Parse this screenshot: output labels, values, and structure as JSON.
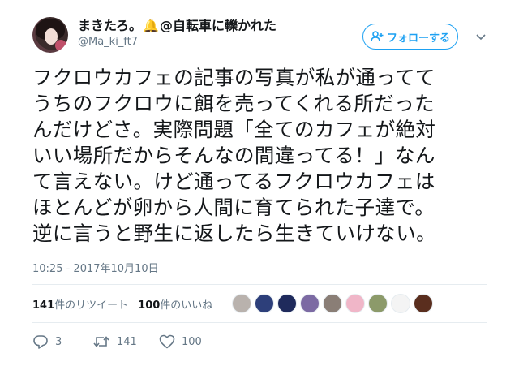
{
  "user": {
    "display_name_prefix": "まきたろ。",
    "display_name_suffix": "@自転車に轢かれた",
    "handle": "@Ma_ki_ft7"
  },
  "follow_button": {
    "label": "フォローする"
  },
  "tweet": {
    "lines": [
      "フクロウカフェの記事の写真が私が通ってて",
      "うちのフクロウに餌を売ってくれる所だった",
      "んだけどさ。実際問題「全てのカフェが絶対",
      "いい場所だからそんなの間違ってる！」なん",
      "て言えない。けど通ってるフクロウカフェは",
      "ほとんどが卵から人間に育てられた子達で。",
      "逆に言うと野生に返したら生きていけない。"
    ],
    "timestamp": "10:25 - 2017年10月10日"
  },
  "stats": {
    "retweets_count": "141",
    "retweets_label": "件のリツイート",
    "likes_count": "100",
    "likes_label": "件のいいね"
  },
  "likers": [
    {
      "icon": "liker-avatar-1",
      "color": "#b9b2ad"
    },
    {
      "icon": "liker-avatar-2",
      "color": "#2d3f7a"
    },
    {
      "icon": "liker-avatar-3",
      "color": "#1f2a5c"
    },
    {
      "icon": "liker-avatar-4",
      "color": "#7c6aa3"
    },
    {
      "icon": "liker-avatar-5",
      "color": "#8a7e76"
    },
    {
      "icon": "liker-avatar-6",
      "color": "#f0b6c8"
    },
    {
      "icon": "liker-avatar-7",
      "color": "#8c9a6a"
    },
    {
      "icon": "liker-avatar-8",
      "color": "#f4f4f4"
    },
    {
      "icon": "liker-avatar-9",
      "color": "#5a2e1e"
    }
  ],
  "actions": {
    "reply_count": "3",
    "retweet_count": "141",
    "like_count": "100"
  },
  "colors": {
    "accent": "#1da1f2",
    "secondary_text": "#657786",
    "bell": "#f5a623"
  }
}
